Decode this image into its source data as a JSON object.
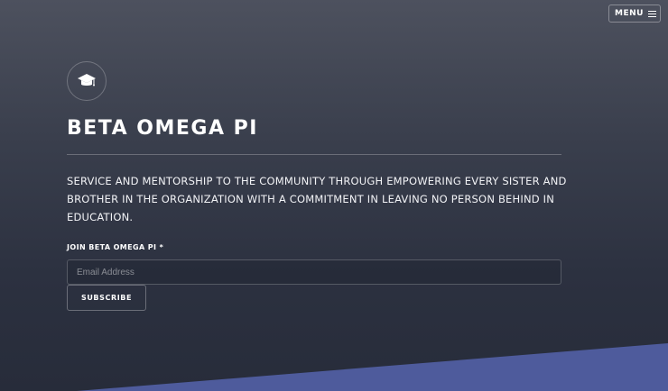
{
  "header": {
    "menu_label": "MENU"
  },
  "brand": {
    "logo_icon": "graduation-cap-icon",
    "title": "BETA OMEGA PI",
    "tagline": "SERVICE AND MENTORSHIP TO THE COMMUNITY THROUGH EMPOWERING EVERY SISTER AND BROTHER IN THE ORGANIZATION WITH A COMMITMENT IN LEAVING NO PERSON BEHIND IN EDUCATION."
  },
  "signup": {
    "label": "JOIN BETA OMEGA PI *",
    "email_value": "",
    "email_placeholder": "Email Address",
    "subscribe_label": "SUBSCRIBE"
  },
  "colors": {
    "accent_wedge": "#4e5b9c",
    "background_top": "#4d515e",
    "background_bottom": "#272c3a"
  }
}
